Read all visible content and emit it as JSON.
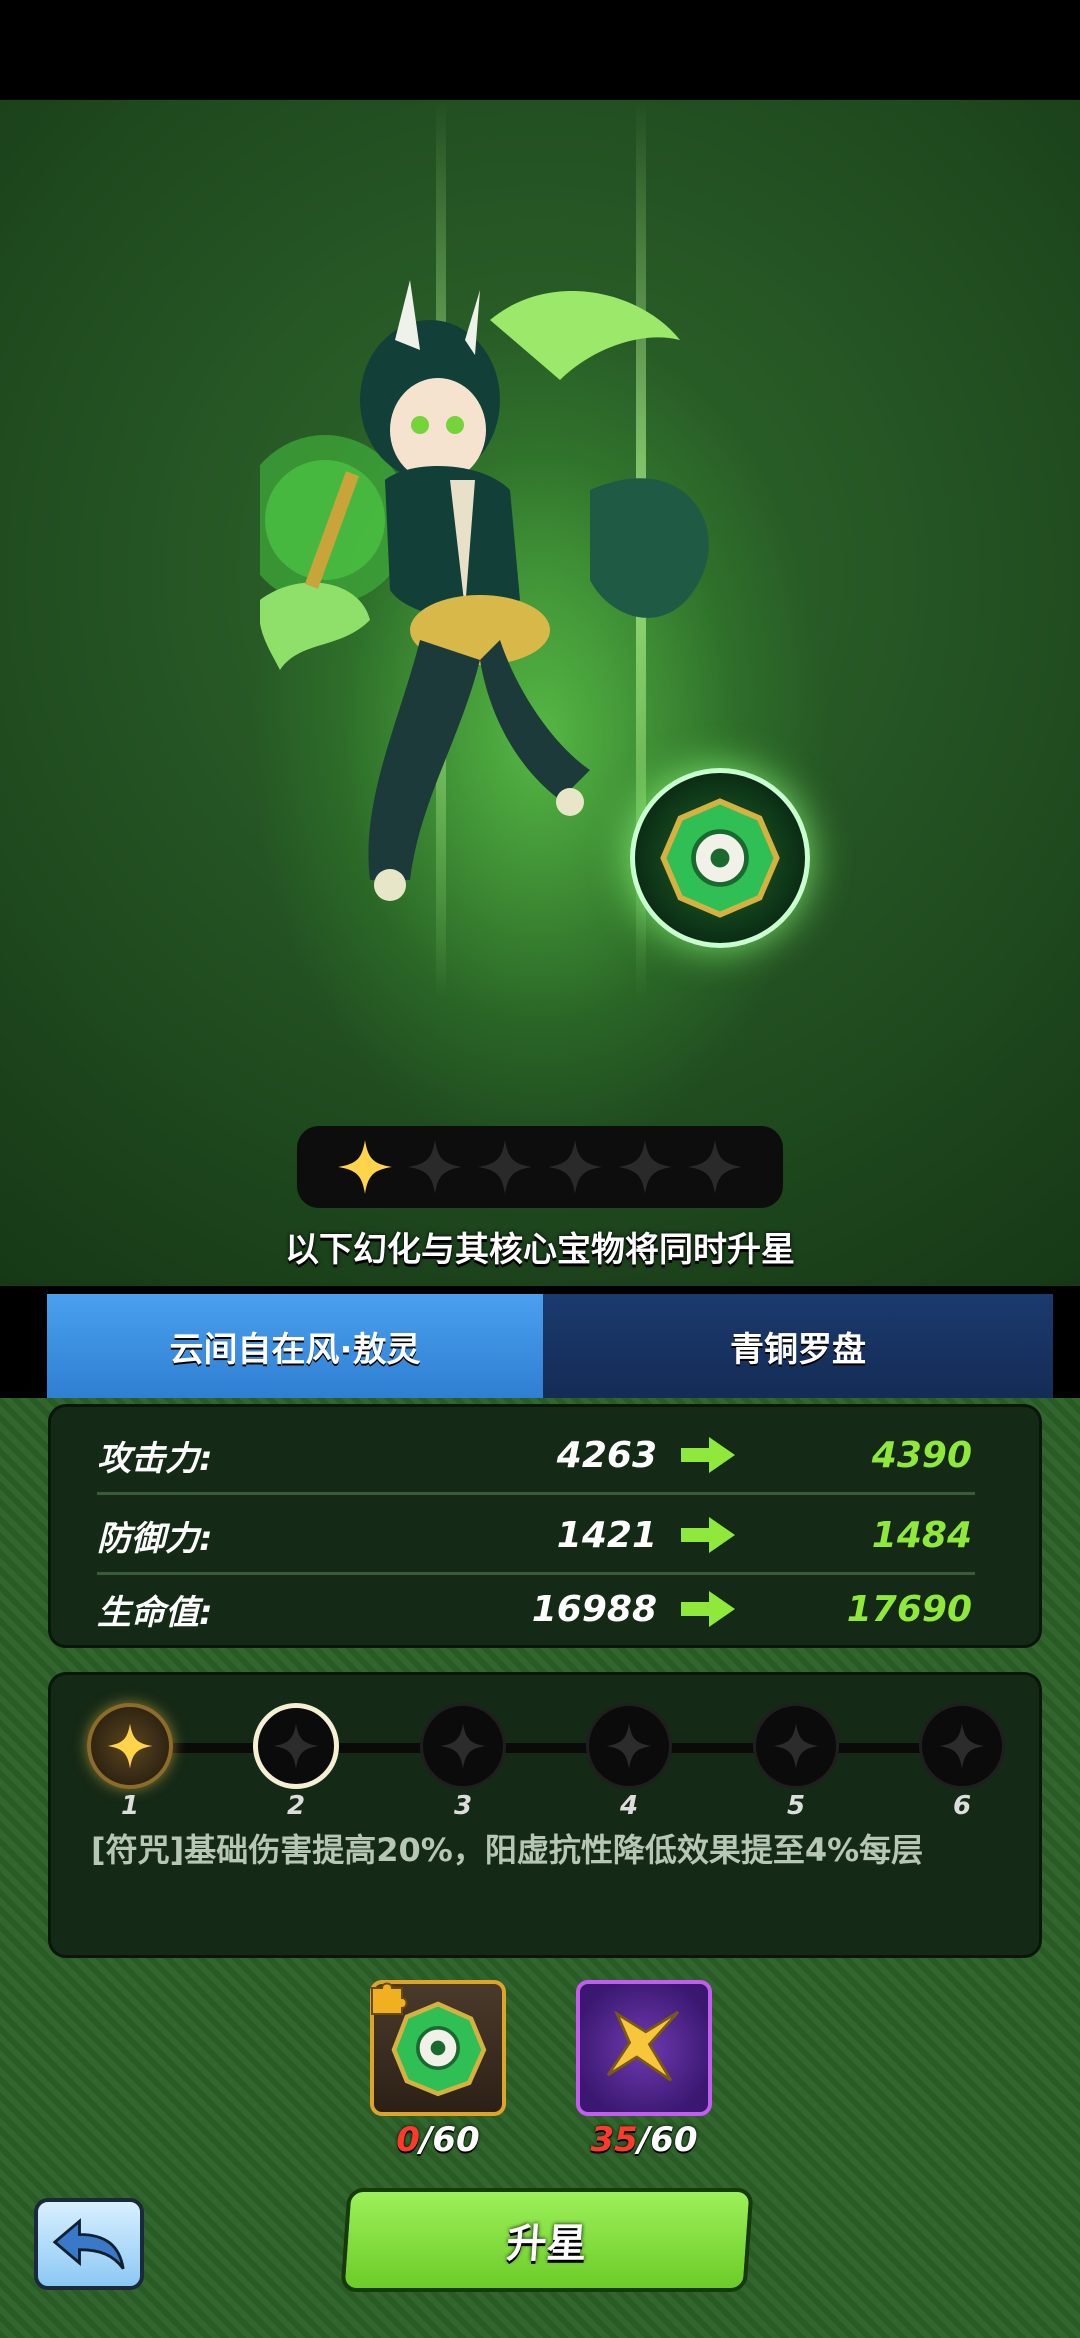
{
  "star_rating": {
    "current": 1,
    "max": 6
  },
  "sync_notice": "以下幻化与其核心宝物将同时升星",
  "tabs": [
    {
      "label": "云间自在风·敖灵",
      "selected": true
    },
    {
      "label": "青铜罗盘",
      "selected": false
    }
  ],
  "stats": [
    {
      "label": "攻击力:",
      "current": "4263",
      "next": "4390"
    },
    {
      "label": "防御力:",
      "current": "1421",
      "next": "1484"
    },
    {
      "label": "生命值:",
      "current": "16988",
      "next": "17690"
    }
  ],
  "star_nodes": [
    "1",
    "2",
    "3",
    "4",
    "5",
    "6"
  ],
  "active_node": 1,
  "skill_description": "[符咒]基础伤害提高20%，阳虚抗性降低效果提至4%每层",
  "materials": [
    {
      "icon": "bronze-compass-fragment-icon",
      "have": "0",
      "need": "/60"
    },
    {
      "icon": "gold-star-icon",
      "have": "35",
      "need": "/60"
    }
  ],
  "upgrade_button_label": "升星",
  "colors": {
    "stat_new": "#8fe83a",
    "tab_active": "#3b8fe0",
    "tab_inactive": "#142c56",
    "button_green": "#7fd93a",
    "insufficient": "#ff3a2a"
  }
}
